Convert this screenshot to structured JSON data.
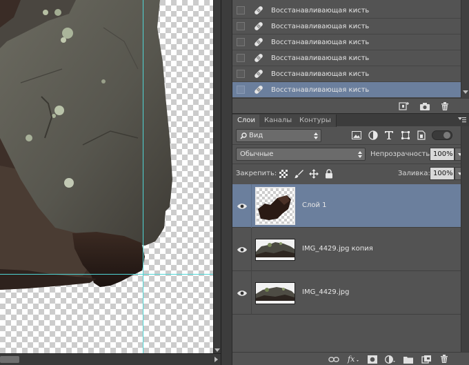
{
  "history": {
    "items": [
      {
        "label": "Восстанавливающая кисть",
        "icon": "healing-brush-icon"
      },
      {
        "label": "Восстанавливающая кисть",
        "icon": "healing-brush-icon"
      },
      {
        "label": "Восстанавливающая кисть",
        "icon": "healing-brush-icon"
      },
      {
        "label": "Восстанавливающая кисть",
        "icon": "healing-brush-icon"
      },
      {
        "label": "Восстанавливающая кисть",
        "icon": "healing-brush-icon"
      },
      {
        "label": "Восстанавливающая кисть",
        "icon": "healing-brush-icon",
        "selected": true
      }
    ]
  },
  "tabs": [
    {
      "label": "Слои",
      "active": true
    },
    {
      "label": "Каналы"
    },
    {
      "label": "Контуры"
    }
  ],
  "filter": {
    "kind_label": "Вид"
  },
  "blend": {
    "mode": "Обычные",
    "opacity_label": "Непрозрачность:",
    "opacity_value": "100%"
  },
  "lock": {
    "label": "Закрепить:",
    "fill_label": "Заливка:",
    "fill_value": "100%"
  },
  "layers": [
    {
      "name": "Слой 1",
      "visible": true,
      "selected": true
    },
    {
      "name": "IMG_4429.jpg копия",
      "visible": true
    },
    {
      "name": "IMG_4429.jpg",
      "visible": true
    }
  ],
  "colors": {
    "selection": "#6b7f9d",
    "panel_bg": "#535353",
    "guide": "#4fd6d6"
  }
}
